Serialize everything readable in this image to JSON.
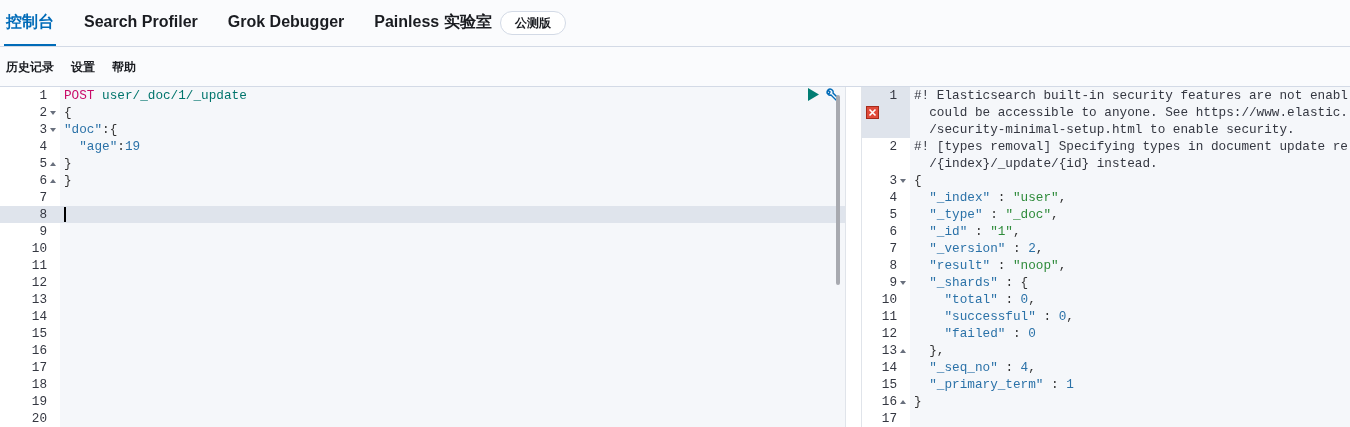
{
  "tabs": [
    {
      "label": "控制台",
      "selected": true
    },
    {
      "label": "Search Profiler",
      "selected": false
    },
    {
      "label": "Grok Debugger",
      "selected": false
    },
    {
      "label": "Painless 实验室",
      "selected": false
    }
  ],
  "beta_badge": "公测版",
  "menu": [
    "历史记录",
    "设置",
    "帮助"
  ],
  "request": {
    "lines": [
      {
        "number": "1",
        "active": false,
        "segs": [
          {
            "kind": "method",
            "text": "POST"
          },
          {
            "kind": "url",
            "text": " user/_doc/1/_update"
          }
        ]
      },
      {
        "number": "2",
        "active": false,
        "expanded": true,
        "segs": [
          {
            "kind": "punct",
            "text": "{"
          }
        ]
      },
      {
        "number": "3",
        "active": false,
        "expanded": true,
        "segs": [
          {
            "kind": "key",
            "text": "\"doc\""
          },
          {
            "kind": "punct",
            "text": ":{"
          }
        ]
      },
      {
        "number": "4",
        "active": false,
        "segs": [
          {
            "kind": "key",
            "text": "  \"age\""
          },
          {
            "kind": "punct",
            "text": ":"
          },
          {
            "kind": "number",
            "text": "19"
          }
        ]
      },
      {
        "number": "5",
        "active": false,
        "expanded": false,
        "segs": [
          {
            "kind": "punct",
            "text": "}"
          }
        ]
      },
      {
        "number": "6",
        "active": false,
        "expanded": false,
        "segs": [
          {
            "kind": "punct",
            "text": "}"
          }
        ]
      },
      {
        "number": "7",
        "active": false
      },
      {
        "number": "8",
        "active": true
      },
      {
        "number": "9",
        "active": false
      },
      {
        "number": "10",
        "active": false
      },
      {
        "number": "11",
        "active": false
      },
      {
        "number": "12",
        "active": false
      },
      {
        "number": "13",
        "active": false
      },
      {
        "number": "14",
        "active": false
      },
      {
        "number": "15",
        "active": false
      },
      {
        "number": "16",
        "active": false
      },
      {
        "number": "17",
        "active": false
      },
      {
        "number": "18",
        "active": false
      },
      {
        "number": "19",
        "active": false
      },
      {
        "number": "20",
        "active": false
      }
    ]
  },
  "response": {
    "lines": [
      {
        "number": "1",
        "error": true,
        "rows": [
          [
            {
              "kind": "comment",
              "text": "#! Elasticsearch built-in security features are not enabl"
            }
          ],
          [
            {
              "kind": "comment",
              "text": "  could be accessible to anyone. See https://www.elastic."
            }
          ],
          [
            {
              "kind": "comment",
              "text": "  /security-minimal-setup.html to enable security."
            }
          ]
        ]
      },
      {
        "number": "2",
        "error": false,
        "rows": [
          [
            {
              "kind": "comment",
              "text": "#! [types removal] Specifying types in document update re"
            }
          ],
          [
            {
              "kind": "comment",
              "text": "  /{index}/_update/{id} instead."
            }
          ]
        ]
      },
      {
        "number": "3",
        "error": false,
        "expanded": true,
        "rows": [
          [
            {
              "kind": "punct",
              "text": "{"
            }
          ]
        ]
      },
      {
        "number": "4",
        "error": false,
        "rows": [
          [
            {
              "kind": "key",
              "text": "  \"_index\""
            },
            {
              "kind": "punct",
              "text": " : "
            },
            {
              "kind": "string",
              "text": "\"user\""
            },
            {
              "kind": "punct",
              "text": ","
            }
          ]
        ]
      },
      {
        "number": "5",
        "error": false,
        "rows": [
          [
            {
              "kind": "key",
              "text": "  \"_type\""
            },
            {
              "kind": "punct",
              "text": " : "
            },
            {
              "kind": "string",
              "text": "\"_doc\""
            },
            {
              "kind": "punct",
              "text": ","
            }
          ]
        ]
      },
      {
        "number": "6",
        "error": false,
        "rows": [
          [
            {
              "kind": "key",
              "text": "  \"_id\""
            },
            {
              "kind": "punct",
              "text": " : "
            },
            {
              "kind": "string",
              "text": "\"1\""
            },
            {
              "kind": "punct",
              "text": ","
            }
          ]
        ]
      },
      {
        "number": "7",
        "error": false,
        "rows": [
          [
            {
              "kind": "key",
              "text": "  \"_version\""
            },
            {
              "kind": "punct",
              "text": " : "
            },
            {
              "kind": "number",
              "text": "2"
            },
            {
              "kind": "punct",
              "text": ","
            }
          ]
        ]
      },
      {
        "number": "8",
        "error": false,
        "rows": [
          [
            {
              "kind": "key",
              "text": "  \"result\""
            },
            {
              "kind": "punct",
              "text": " : "
            },
            {
              "kind": "string",
              "text": "\"noop\""
            },
            {
              "kind": "punct",
              "text": ","
            }
          ]
        ]
      },
      {
        "number": "9",
        "error": false,
        "expanded": true,
        "rows": [
          [
            {
              "kind": "key",
              "text": "  \"_shards\""
            },
            {
              "kind": "punct",
              "text": " : {"
            }
          ]
        ]
      },
      {
        "number": "10",
        "error": false,
        "rows": [
          [
            {
              "kind": "key",
              "text": "    \"total\""
            },
            {
              "kind": "punct",
              "text": " : "
            },
            {
              "kind": "number",
              "text": "0"
            },
            {
              "kind": "punct",
              "text": ","
            }
          ]
        ]
      },
      {
        "number": "11",
        "error": false,
        "rows": [
          [
            {
              "kind": "key",
              "text": "    \"successful\""
            },
            {
              "kind": "punct",
              "text": " : "
            },
            {
              "kind": "number",
              "text": "0"
            },
            {
              "kind": "punct",
              "text": ","
            }
          ]
        ]
      },
      {
        "number": "12",
        "error": false,
        "rows": [
          [
            {
              "kind": "key",
              "text": "    \"failed\""
            },
            {
              "kind": "punct",
              "text": " : "
            },
            {
              "kind": "number",
              "text": "0"
            }
          ]
        ]
      },
      {
        "number": "13",
        "error": false,
        "expanded": false,
        "rows": [
          [
            {
              "kind": "punct",
              "text": "  },"
            }
          ]
        ]
      },
      {
        "number": "14",
        "error": false,
        "rows": [
          [
            {
              "kind": "key",
              "text": "  \"_seq_no\""
            },
            {
              "kind": "punct",
              "text": " : "
            },
            {
              "kind": "number",
              "text": "4"
            },
            {
              "kind": "punct",
              "text": ","
            }
          ]
        ]
      },
      {
        "number": "15",
        "error": false,
        "rows": [
          [
            {
              "kind": "key",
              "text": "  \"_primary_term\""
            },
            {
              "kind": "punct",
              "text": " : "
            },
            {
              "kind": "number",
              "text": "1"
            }
          ]
        ]
      },
      {
        "number": "16",
        "error": false,
        "expanded": false,
        "rows": [
          [
            {
              "kind": "punct",
              "text": "}"
            }
          ]
        ]
      },
      {
        "number": "17",
        "error": false
      }
    ]
  }
}
